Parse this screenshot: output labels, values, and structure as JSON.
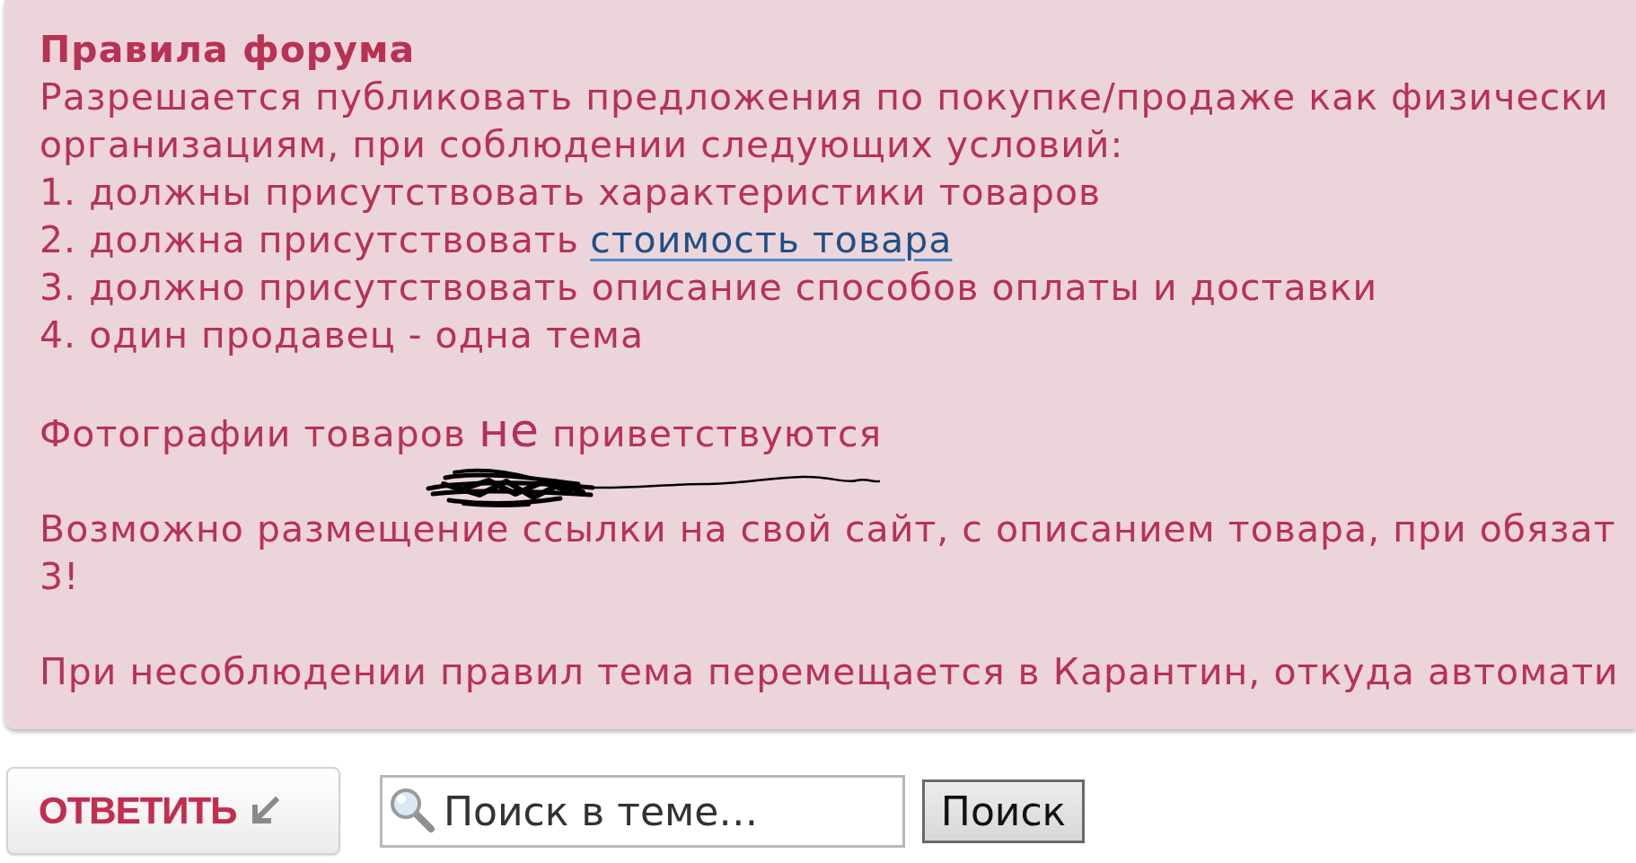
{
  "rules_panel": {
    "title": "Правила форума",
    "intro_lines": [
      "Разрешается публиковать предложения по покупке/продаже как физически",
      "организациям, при соблюдении следующих условий:"
    ],
    "conditions": [
      {
        "text": "1. должны присутствовать характеристики товаров"
      },
      {
        "text": "2. должна присутствовать",
        "link": "стоимость товара"
      },
      {
        "text": "3. должно присутствовать описание способов оплаты и доставки"
      },
      {
        "text": "4. один продавец - одна тема"
      }
    ],
    "photo_note": {
      "before": "Фотографии товаров",
      "emphasis": "не",
      "after": "приветствуются"
    },
    "link_note_lines": [
      "Возможно размещение ссылки на свой сайт, с описанием товара, при обязат",
      "3!"
    ],
    "penalty_line": "При несоблюдении правил тема перемещается в Карантин, откуда автомати"
  },
  "actions": {
    "reply_button": "ОТВЕТИТЬ",
    "search": {
      "placeholder": "Поиск в теме…"
    },
    "search_button": "Поиск"
  }
}
